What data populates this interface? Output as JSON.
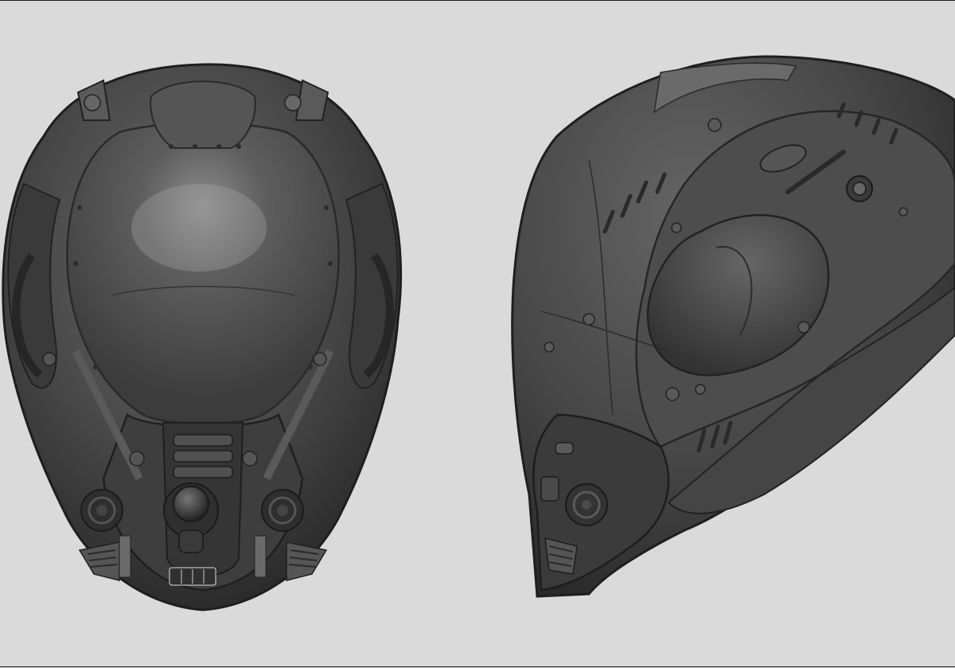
{
  "scene": {
    "background_color": "#dadada",
    "frame_color": "#1c1c1c",
    "material_color": "#4a4a4a",
    "subjects": [
      {
        "id": "front-view",
        "icon": "helmet-top-view"
      },
      {
        "id": "side-view",
        "icon": "helmet-side-view"
      }
    ]
  }
}
